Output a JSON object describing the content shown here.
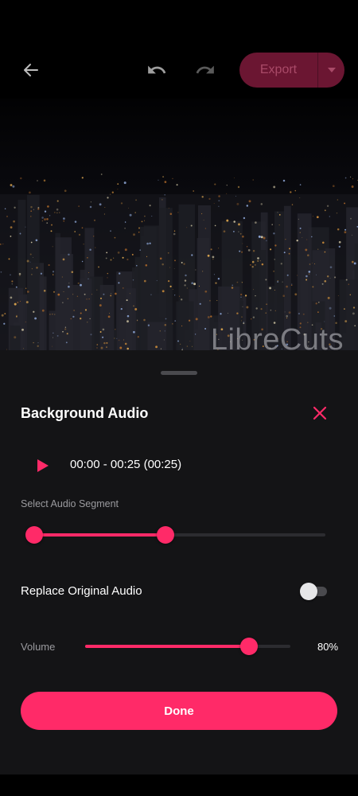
{
  "toolbar": {
    "back_icon": "arrow-left-icon",
    "undo_icon": "undo-icon",
    "redo_icon": "redo-icon",
    "export_label": "Export",
    "export_menu_icon": "caret-down-icon"
  },
  "preview": {
    "watermark": "LibreCuts"
  },
  "sheet": {
    "title": "Background Audio",
    "close_icon": "close-icon",
    "play_icon": "play-icon",
    "time_range": "00:00 - 00:25 (00:25)",
    "segment_label": "Select Audio Segment",
    "segment_start_fraction": 0.0,
    "segment_end_fraction": 0.45,
    "replace_label": "Replace Original Audio",
    "replace_enabled": false,
    "volume_label": "Volume",
    "volume_percent": 80,
    "volume_display": "80%",
    "done_label": "Done"
  },
  "colors": {
    "accent": "#ff2a68",
    "export_bg_disabled": "#6b1632",
    "sheet_bg": "#141416",
    "track_bg": "#2c2c30"
  }
}
